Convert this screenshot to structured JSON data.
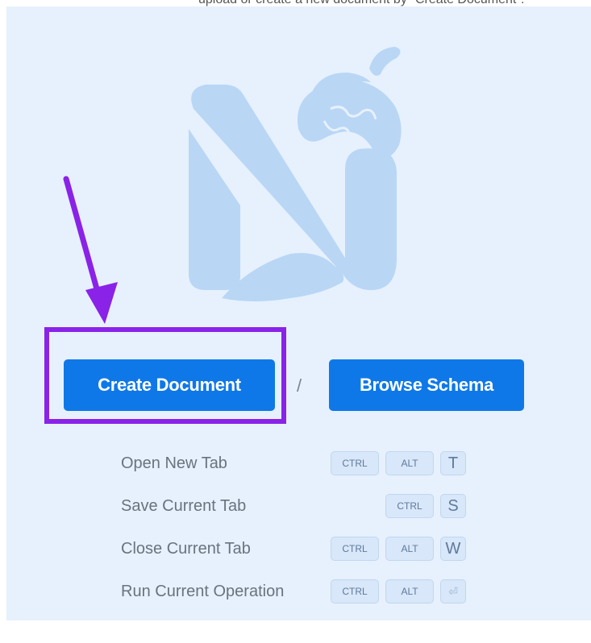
{
  "header": {
    "partial_text": "upload or create a new document by \"Create Document\"."
  },
  "actions": {
    "create_document": "Create Document",
    "separator": "/",
    "browse_schema": "Browse Schema"
  },
  "shortcuts": [
    {
      "label": "Open New Tab",
      "keys": [
        "CTRL",
        "ALT",
        "T"
      ]
    },
    {
      "label": "Save Current Tab",
      "keys": [
        "CTRL",
        "S"
      ]
    },
    {
      "label": "Close Current Tab",
      "keys": [
        "CTRL",
        "ALT",
        "W"
      ]
    },
    {
      "label": "Run Current Operation",
      "keys": [
        "CTRL",
        "ALT",
        "⏎"
      ]
    }
  ],
  "colors": {
    "panel_bg": "#e6f1fd",
    "button": "#0f78e8",
    "highlight": "#8a22e8",
    "logo": "#b9d6f5"
  }
}
